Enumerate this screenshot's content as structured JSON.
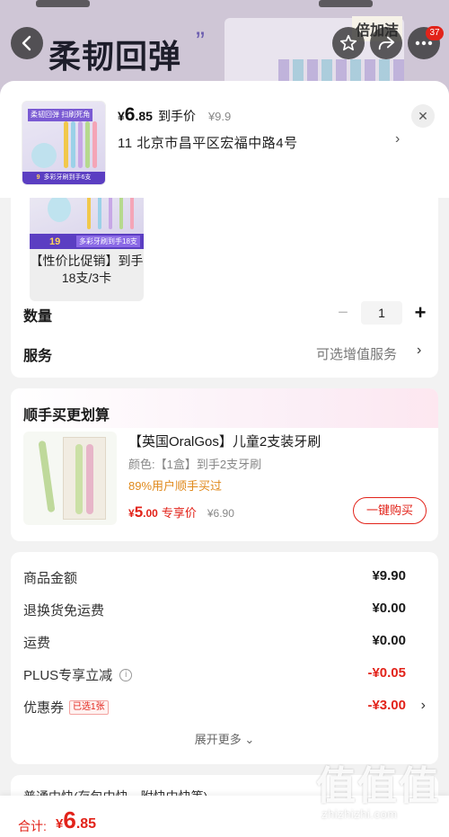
{
  "background": {
    "headline": "柔韧回弹",
    "brand_box_text": "倍加洁",
    "cart_badge": "37"
  },
  "product": {
    "thumb_tag": "柔韧回弹 扫刷死角",
    "thumb_price": "9",
    "thumb_footer": "多彩牙刷到手6支",
    "price_currency": "¥",
    "price_int": "6",
    "price_dec": ".85",
    "price_tag": "到手价",
    "price_orig": "¥9.9",
    "address": "11  北京市昌平区宏福中路4号"
  },
  "spec": {
    "price_small": "19",
    "tag": "多彩牙刷到手18支",
    "label": "【性价比促销】到手18支/3卡"
  },
  "quantity": {
    "label": "数量",
    "value": "1",
    "minus": "−",
    "plus": "+"
  },
  "service": {
    "label": "服务",
    "hint": "可选增值服务"
  },
  "combo": {
    "title": "顺手买更划算",
    "name": "【英国OralGos】儿童2支装牙刷",
    "spec": "颜色:【1盒】到手2支牙刷",
    "hint": "89%用户顺手买过",
    "price_currency": "¥",
    "price_int": "5",
    "price_dec": ".00",
    "price_tag": "专享价",
    "price_orig": "¥6.90",
    "button": "一键购买"
  },
  "summary": {
    "rows": [
      {
        "label": "商品金额",
        "value": "¥9.90"
      },
      {
        "label": "退换货免运费",
        "value": "¥0.00"
      },
      {
        "label": "运费",
        "value": "¥0.00"
      },
      {
        "label": "PLUS专享立减",
        "value": "-¥0.05"
      },
      {
        "label": "优惠券",
        "value": "-¥3.00"
      }
    ],
    "coupon_badge": "已选1张",
    "expand": "展开更多 ⌄"
  },
  "next_section": {
    "text": "普通中快(存包中快、附快中快等)"
  },
  "footer": {
    "total_label": "合计:",
    "currency": "¥",
    "int": "6",
    "dec": ".85"
  },
  "watermark": {
    "glyphs": "值值值",
    "url": "zhizhizhi.com"
  },
  "colors": {
    "accent_red": "#e2231a",
    "orange_hint": "#e08a1d",
    "purple": "#5b3ec2"
  }
}
